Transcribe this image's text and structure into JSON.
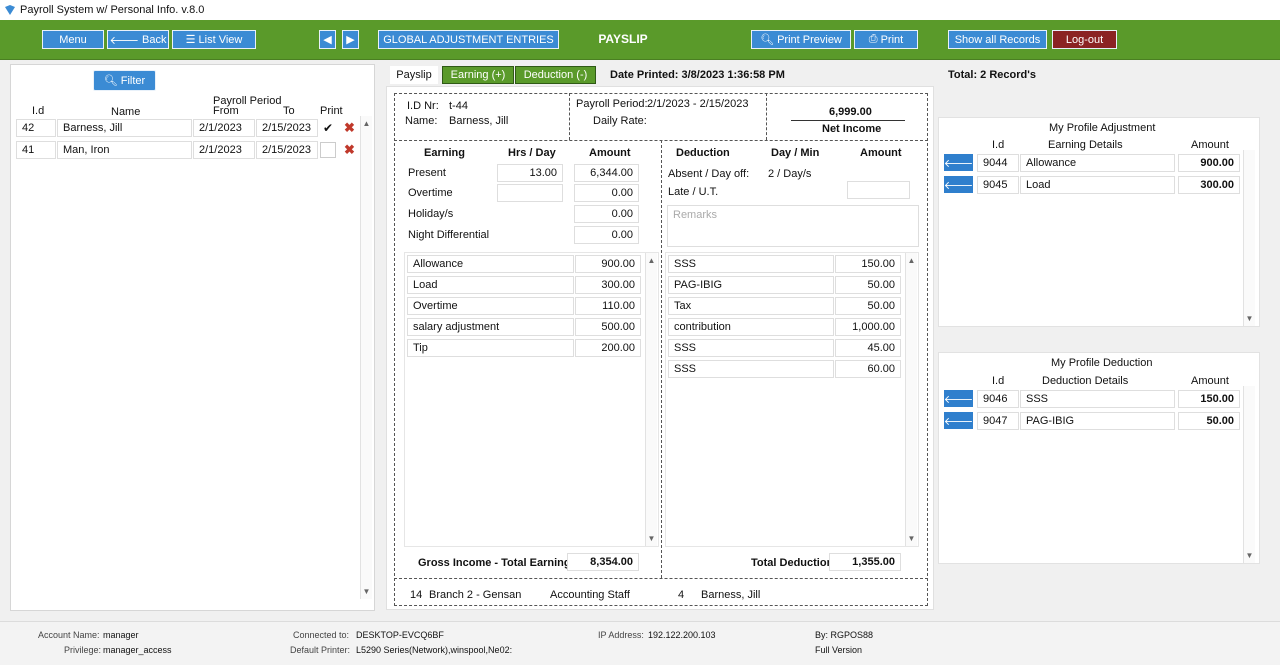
{
  "window": {
    "title": "Payroll System w/ Personal Info. v.8.0"
  },
  "toolbar": {
    "menu": "Menu",
    "back": "Back",
    "list_view": "List View",
    "global_adjustment": "GLOBAL ADJUSTMENT ENTRIES",
    "title": "PAYSLIP",
    "print_preview": "Print Preview",
    "print": "Print",
    "show_all": "Show all Records",
    "logout": "Log-out"
  },
  "left": {
    "filter": "Filter",
    "col_id": "I.d",
    "col_name": "Name",
    "col_period": "Payroll Period",
    "col_from": "From",
    "col_to": "To",
    "col_print": "Print",
    "rows": [
      {
        "id": "42",
        "name": "Barness,  Jill",
        "from": "2/1/2023",
        "to": "2/15/2023",
        "checked": "✔"
      },
      {
        "id": "41",
        "name": "Man,  Iron",
        "from": "2/1/2023",
        "to": "2/15/2023",
        "checked": ""
      }
    ]
  },
  "tabs": {
    "payslip": "Payslip",
    "earning": "Earning (+)",
    "deduction": "Deduction (-)"
  },
  "date_printed": "Date Printed: 3/8/2023 1:36:58 PM",
  "total_records": "Total: 2 Record's",
  "slip": {
    "id_label": "I.D Nr:",
    "id_value": "t-44",
    "name_label": "Name:",
    "name_value": "Barness,  Jill",
    "period_label": "Payroll Period:",
    "period_value": "2/1/2023 - 2/15/2023",
    "daily_rate_label": "Daily Rate:",
    "net_amount": "6,999.00",
    "net_label": "Net Income",
    "earning_hdr": "Earning",
    "hrs_hdr": "Hrs / Day",
    "amount_hdr": "Amount",
    "present_label": "Present",
    "present_hrs": "13.00",
    "present_amt": "6,344.00",
    "overtime_label": "Overtime",
    "overtime_amt": "0.00",
    "holiday_label": "Holiday/s",
    "holiday_amt": "0.00",
    "night_label": "Night Differential",
    "night_amt": "0.00",
    "earn_items": [
      {
        "name": "Allowance",
        "amount": "900.00"
      },
      {
        "name": "Load",
        "amount": "300.00"
      },
      {
        "name": "Overtime",
        "amount": "110.00"
      },
      {
        "name": "salary  adjustment",
        "amount": "500.00"
      },
      {
        "name": "Tip",
        "amount": "200.00"
      }
    ],
    "deduction_hdr": "Deduction",
    "daymin_hdr": "Day / Min",
    "ded_amount_hdr": "Amount",
    "absent_label": "Absent / Day off:",
    "absent_value": "2 / Day/s",
    "late_label": "Late / U.T.",
    "remarks_placeholder": "Remarks",
    "ded_items": [
      {
        "name": "SSS",
        "amount": "150.00"
      },
      {
        "name": "PAG-IBIG",
        "amount": "50.00"
      },
      {
        "name": "Tax",
        "amount": "50.00"
      },
      {
        "name": "contribution",
        "amount": "1,000.00"
      },
      {
        "name": "SSS",
        "amount": "45.00"
      },
      {
        "name": "SSS",
        "amount": "60.00"
      }
    ],
    "gross_label": "Gross Income - Total Earning:",
    "gross_value": "8,354.00",
    "total_ded_label": "Total Deduction:",
    "total_ded_value": "1,355.00",
    "footer": {
      "emp_no": "14",
      "branch": "Branch 2 - Gensan",
      "position": "Accounting Staff",
      "num": "4",
      "name": "Barness,  Jill"
    }
  },
  "profile_adj": {
    "title": "My Profile Adjustment",
    "col_id": "I.d",
    "col_details": "Earning  Details",
    "col_amount": "Amount",
    "rows": [
      {
        "id": "9044",
        "details": "Allowance",
        "amount": "900.00"
      },
      {
        "id": "9045",
        "details": "Load",
        "amount": "300.00"
      }
    ]
  },
  "profile_ded": {
    "title": "My Profile Deduction",
    "col_id": "I.d",
    "col_details": "Deduction  Details",
    "col_amount": "Amount",
    "rows": [
      {
        "id": "9046",
        "details": "SSS",
        "amount": "150.00"
      },
      {
        "id": "9047",
        "details": "PAG-IBIG",
        "amount": "50.00"
      }
    ]
  },
  "status": {
    "account_label": "Account Name:",
    "account_value": "manager",
    "privilege_label": "Privilege:",
    "privilege_value": "manager_access",
    "connected_label": "Connected to:",
    "connected_value": "DESKTOP-EVCQ6BF",
    "printer_label": "Default Printer:",
    "printer_value": "L5290 Series(Network),winspool,Ne02:",
    "ip_label": "IP Address:",
    "ip_value": "192.122.200.103",
    "by": "By: RGPOS88",
    "version": "Full Version"
  },
  "icons": {
    "back": "arrow-left-icon",
    "list": "list-icon",
    "search": "search-icon",
    "print": "printer-icon",
    "transfer": "arrow-left-icon"
  }
}
